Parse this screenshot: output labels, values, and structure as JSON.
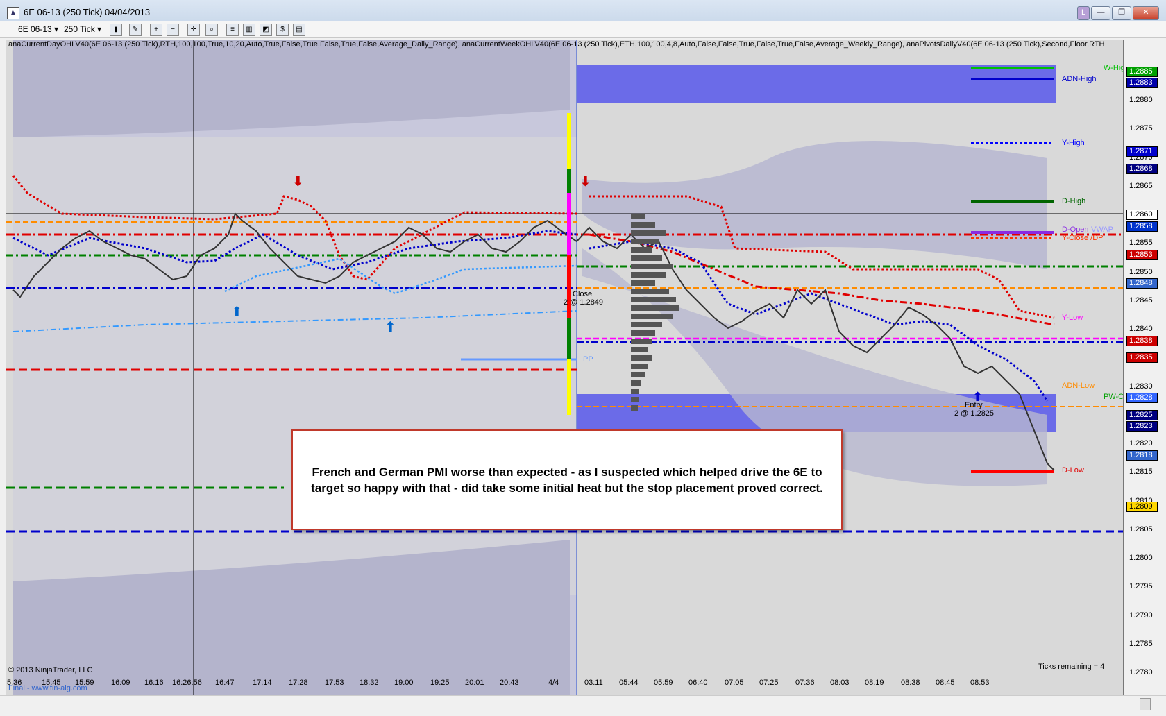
{
  "window": {
    "title": "6E 06-13 (250 Tick)  04/04/2013",
    "buttons": [
      "L",
      "—",
      "❐",
      "✕"
    ]
  },
  "toolbar": {
    "instrument": "6E 06-13",
    "interval": "250 Tick"
  },
  "indicators_text": "anaCurrentDayOHLV40(6E 06-13 (250 Tick),RTH,100,100,True,10,20,Auto,True,False,True,False,True,False,Average_Daily_Range), anaCurrentWeekOHLV40(6E 06-13 (250 Tick),ETH,100,100,4,8,Auto,False,False,True,False,True,False,Average_Weekly_Range), anaPivotsDailyV40(6E 06-13 (250 Tick),Second,Floor,RTH",
  "price_axis": {
    "ticks": [
      "1.2885",
      "1.2880",
      "1.2875",
      "1.2870",
      "1.2865",
      "1.2860",
      "1.2855",
      "1.2850",
      "1.2845",
      "1.2840",
      "1.2835",
      "1.2830",
      "1.2825",
      "1.2820",
      "1.2815",
      "1.2810",
      "1.2805",
      "1.2800",
      "1.2795",
      "1.2790",
      "1.2785",
      "1.2780"
    ],
    "tags": [
      {
        "value": "1.2885",
        "color": "#00a000"
      },
      {
        "value": "1.2883",
        "color": "#0000aa"
      },
      {
        "value": "1.2871",
        "color": "#0000cc"
      },
      {
        "value": "1.2868",
        "color": "#000080"
      },
      {
        "value": "1.2860",
        "color": "#ffffff"
      },
      {
        "value": "1.2858",
        "color": "#0033cc"
      },
      {
        "value": "1.2853",
        "color": "#cc0000"
      },
      {
        "value": "1.2848",
        "color": "#3366cc"
      },
      {
        "value": "1.2838",
        "color": "#cc0000"
      },
      {
        "value": "1.2835",
        "color": "#cc0000"
      },
      {
        "value": "1.2828",
        "color": "#3366ff"
      },
      {
        "value": "1.2825",
        "color": "#000080"
      },
      {
        "value": "1.2823",
        "color": "#000080"
      },
      {
        "value": "1.2818",
        "color": "#3366cc"
      },
      {
        "value": "1.2809",
        "color": "#ffd700"
      }
    ]
  },
  "time_axis": [
    "5:36",
    "15:45",
    "15:59",
    "16:09",
    "16:16",
    "16:26:56",
    "16:47",
    "17:14",
    "17:28",
    "17:53",
    "18:32",
    "19:00",
    "19:25",
    "20:01",
    "20:43",
    "4/4",
    "03:11",
    "05:44",
    "05:59",
    "06:40",
    "07:05",
    "07:25",
    "07:36",
    "08:03",
    "08:19",
    "08:38",
    "08:45",
    "08:53"
  ],
  "level_labels": {
    "w_high": "W-High",
    "adn_high": "ADN-High",
    "y_high": "Y-High",
    "d_high": "D-High",
    "d_open": "D-Open",
    "vwap": "VWAP",
    "y_close": "Y-Close /DP",
    "y_low": "Y-Low",
    "adn_low": "ADN-Low",
    "pw_c": "PW-C",
    "d_low": "D-Low",
    "pp": "PP",
    "close": "Close",
    "close_order": "2 @ 1.2849",
    "entry": "Entry",
    "entry_order": "2 @ 1.2825"
  },
  "annotation": "French and German PMI worse than expected - as I suspected which helped drive the 6E to target so happy with that - did take some initial heat but the stop placement proved correct.",
  "footer": {
    "copyright": "© 2013 NinjaTrader, LLC",
    "site": "Final - www.fin-alg.com",
    "ticks_remaining": "Ticks remaining = 4"
  },
  "colors": {
    "chart_bg": "#d9d9d9",
    "band": "#c8c8dc",
    "blue_box": "#6b6be8",
    "annotation_border": "#c0392b"
  }
}
